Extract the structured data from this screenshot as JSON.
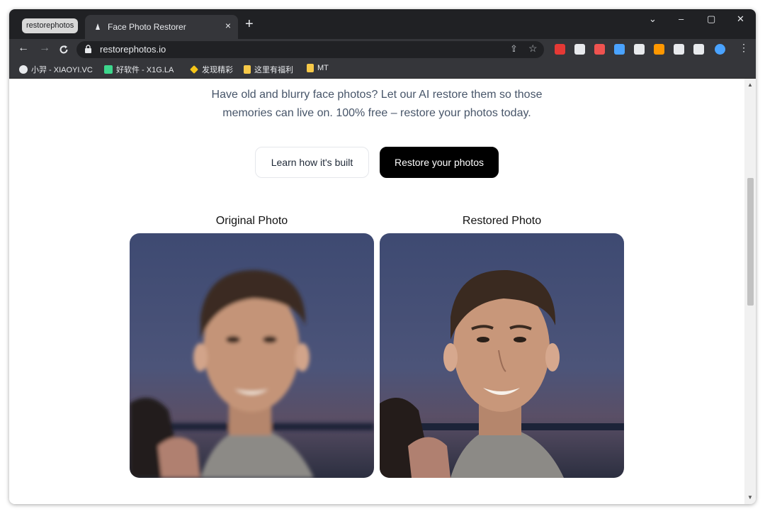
{
  "browser": {
    "tab_group_label": "restorephotos",
    "tab_title": "Face Photo Restorer",
    "tab_close": "×",
    "new_tab": "+",
    "url": "restorephotos.io",
    "controls": {
      "minimize": "–",
      "maximize": "▢",
      "close": "✕",
      "tab_search": "⌄"
    }
  },
  "bookmarks": [
    {
      "label": "小羿 - XIAOYI.VC",
      "color": "#e8eaed"
    },
    {
      "label": "好软件 - X1G.LA",
      "color": "#3dd68c"
    },
    {
      "label": "发现精彩",
      "color": "#f5c518"
    },
    {
      "label": "这里有福利",
      "color": "#f7c948"
    },
    {
      "label": "MT",
      "color": "#f7c948"
    }
  ],
  "extensions": [
    {
      "name": "red-shield-extension-icon",
      "color": "#e53935"
    },
    {
      "name": "glasses-extension-icon",
      "color": "#e8eaed"
    },
    {
      "name": "heart-extension-icon",
      "color": "#ef5350"
    },
    {
      "name": "layers-extension-icon",
      "color": "#4aa3ff"
    },
    {
      "name": "arrow-extension-icon",
      "color": "#e8eaed"
    },
    {
      "name": "orange-extension-icon",
      "color": "#ff9800"
    },
    {
      "name": "puzzle-extensions-icon",
      "color": "#e8eaed"
    },
    {
      "name": "side-panel-icon",
      "color": "#e8eaed"
    },
    {
      "name": "profile-avatar",
      "color": "#4aa3ff"
    }
  ],
  "page": {
    "description_line1": "Have old and blurry face photos? Let our AI restore them so those",
    "description_line2": "memories can live on. 100% free – restore your photos today.",
    "learn_button": "Learn how it's built",
    "restore_button": "Restore your photos",
    "original_title": "Original Photo",
    "restored_title": "Restored Photo"
  }
}
